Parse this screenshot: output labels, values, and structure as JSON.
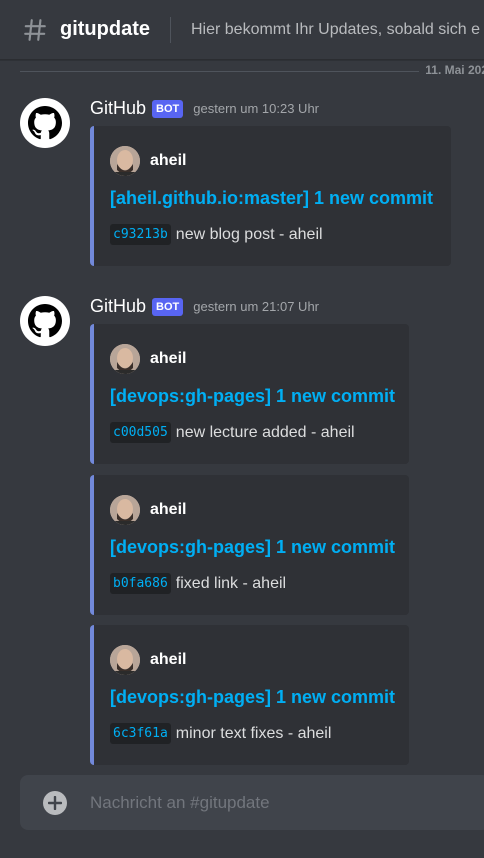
{
  "header": {
    "channel_name": "gitupdate",
    "topic": "Hier bekommt Ihr Updates, sobald sich e"
  },
  "date_divider": "11. Mai 202",
  "messages": [
    {
      "author": "GitHub",
      "bot_tag": "BOT",
      "timestamp": "gestern um 10:23 Uhr",
      "embeds": [
        {
          "author": "aheil",
          "title": "[aheil.github.io:master] 1 new commit",
          "hash": "c93213b",
          "message": "new blog post - aheil"
        }
      ]
    },
    {
      "author": "GitHub",
      "bot_tag": "BOT",
      "timestamp": "gestern um 21:07 Uhr",
      "embeds": [
        {
          "author": "aheil",
          "title": "[devops:gh-pages] 1 new commit",
          "hash": "c00d505",
          "message": "new lecture added - aheil"
        },
        {
          "author": "aheil",
          "title": "[devops:gh-pages] 1 new commit",
          "hash": "b0fa686",
          "message": "fixed link - aheil"
        },
        {
          "author": "aheil",
          "title": "[devops:gh-pages] 1 new commit",
          "hash": "6c3f61a",
          "message": "minor text fixes - aheil"
        }
      ]
    }
  ],
  "input": {
    "placeholder": "Nachricht an #gitupdate"
  },
  "colors": {
    "background": "#36393f",
    "embed_bg": "#2f3136",
    "embed_border": "#7289da",
    "link": "#00aff4",
    "bot_tag": "#5865f2"
  },
  "icons": [
    "hash-icon",
    "github-logo-icon",
    "plus-circle-icon"
  ]
}
